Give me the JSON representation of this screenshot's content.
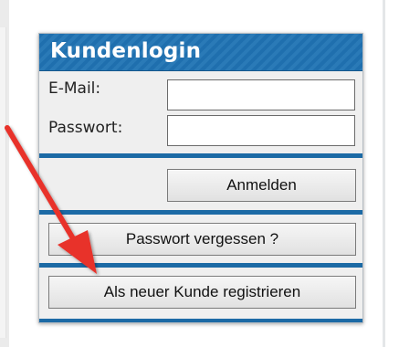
{
  "login": {
    "title": "Kundenlogin",
    "email_label": "E-Mail:",
    "email_value": "",
    "password_label": "Passwort:",
    "password_value": "",
    "login_button": "Anmelden",
    "forgot_button": "Passwort vergessen ?",
    "register_button": "Als neuer Kunde registrieren"
  },
  "colors": {
    "header": "#1f6fae",
    "separator": "#1c6aa5",
    "arrow": "#e8312a"
  },
  "annotation": {
    "icon": "red-arrow-icon"
  }
}
